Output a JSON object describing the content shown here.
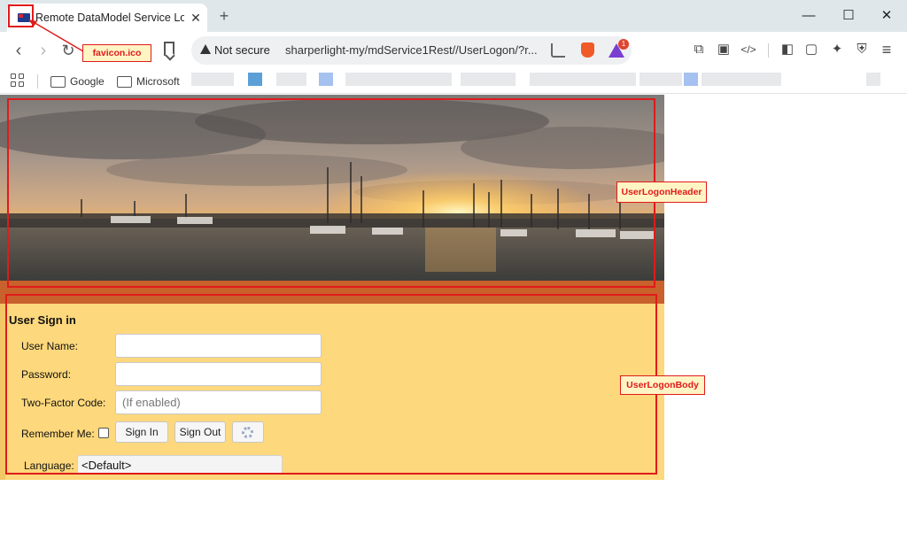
{
  "tab": {
    "title": "Remote DataModel Service Logon",
    "close_label": "✕",
    "new_tab_label": "+"
  },
  "window": {
    "minimize_label": "—",
    "maximize_label": "☐",
    "close_label": "✕"
  },
  "toolbar": {
    "back_label": "‹",
    "forward_label": "›",
    "reload_label": "↻",
    "security_text": "Not secure",
    "url": "sharperlight-my/mdService1Rest//UserLogon/?r...",
    "rewards_badge": "1",
    "extensions_label": "⧉",
    "reader_label": "▣",
    "devtools_label": "</>",
    "sidebar_label": "◧",
    "wallet_label": "▢",
    "leo_label": "✦",
    "vpn_label": "⛨",
    "menu_label": "≡"
  },
  "bookmarks": {
    "items": [
      {
        "label": "Google"
      },
      {
        "label": "Microsoft"
      }
    ]
  },
  "page": {
    "signin_title": "User Sign in",
    "username_label": "User Name:",
    "password_label": "Password:",
    "twofactor_label": "Two-Factor Code:",
    "twofactor_placeholder": "(If enabled)",
    "remember_label": "Remember Me:",
    "signin_button": "Sign In",
    "signout_button": "Sign Out",
    "language_label": "Language:",
    "language_value": "<Default>"
  },
  "annotations": {
    "favicon": "favicon.ico",
    "header": "UserLogonHeader",
    "body": "UserLogonBody"
  },
  "colors": {
    "annotation": "#e01b1b",
    "body_bg": "#fdd87c",
    "orange_bar": "#c9612c"
  }
}
